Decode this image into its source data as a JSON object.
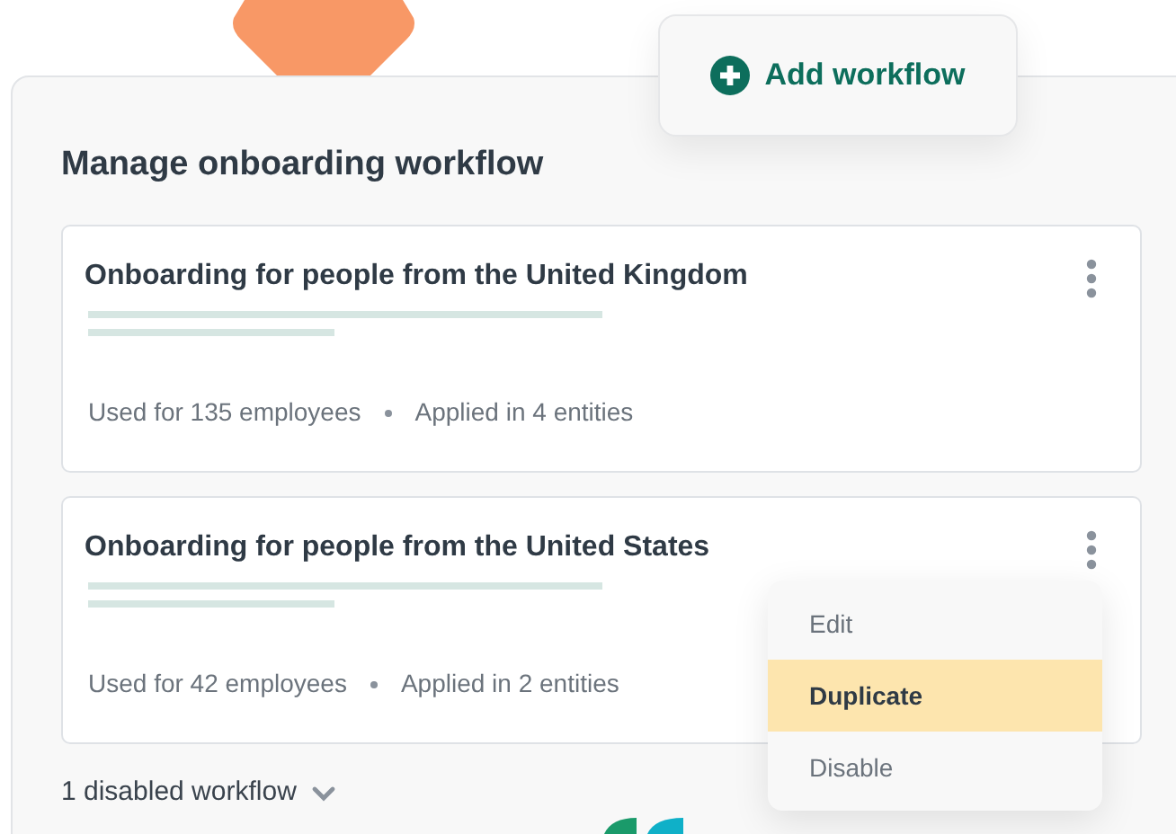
{
  "add_button": {
    "label": "Add workflow"
  },
  "panel": {
    "title": "Manage onboarding workflow"
  },
  "workflows": [
    {
      "title": "Onboarding for people from the United Kingdom",
      "usage": "Used for 135 employees",
      "entities": "Applied in 4 entities"
    },
    {
      "title": "Onboarding for people from the United States",
      "usage": "Used for 42 employees",
      "entities": "Applied in 2 entities"
    }
  ],
  "context_menu": {
    "items": [
      {
        "label": "Edit",
        "selected": false
      },
      {
        "label": "Duplicate",
        "selected": true
      },
      {
        "label": "Disable",
        "selected": false
      }
    ]
  },
  "disabled_toggle": {
    "label": "1 disabled workflow",
    "expanded": false
  }
}
